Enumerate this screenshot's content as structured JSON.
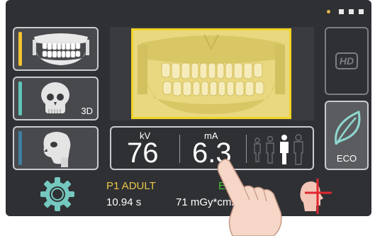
{
  "topbar": {
    "page_dots": 4,
    "active_dot": 1
  },
  "modes": [
    {
      "name": "panoramic",
      "accent": "#f2c230"
    },
    {
      "name": "3d",
      "label": "3D",
      "accent": "#5fc3b8"
    },
    {
      "name": "cephalometric",
      "accent": "#3f7fa0"
    }
  ],
  "exposure": {
    "kv_label": "kV",
    "kv_value": "76",
    "ma_label": "mA",
    "ma_value": "6.3"
  },
  "hd": {
    "label": "HD"
  },
  "eco": {
    "label": "ECO"
  },
  "status": {
    "patient": "P1 ADULT",
    "mode": "ECO",
    "time": "10.94 s",
    "dose": "71 mGy*cm2"
  },
  "colors": {
    "patient": "#e8c64a",
    "eco": "#49c23a",
    "preview_fill": "#e9d87f",
    "preview_border": "#f2d327"
  }
}
